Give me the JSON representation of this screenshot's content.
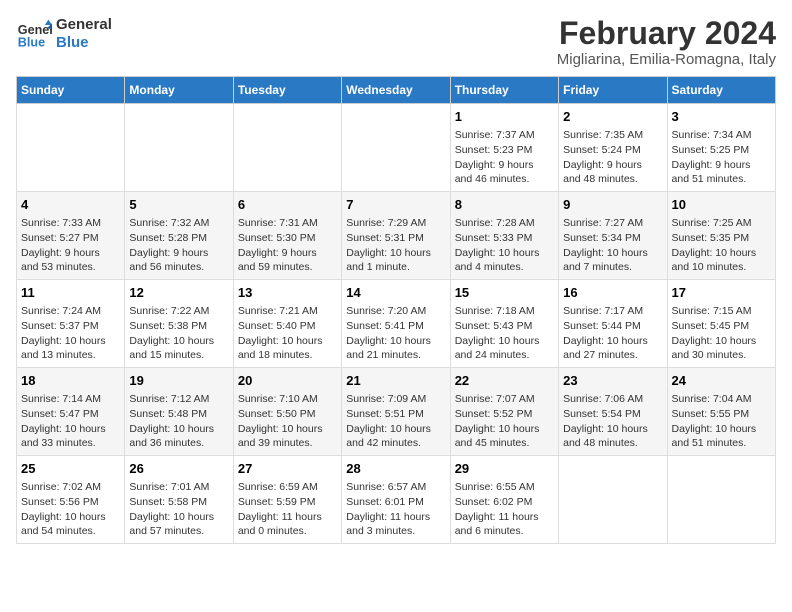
{
  "logo": {
    "line1": "General",
    "line2": "Blue"
  },
  "title": "February 2024",
  "subtitle": "Migliarina, Emilia-Romagna, Italy",
  "weekdays": [
    "Sunday",
    "Monday",
    "Tuesday",
    "Wednesday",
    "Thursday",
    "Friday",
    "Saturday"
  ],
  "weeks": [
    [
      {
        "num": "",
        "info": ""
      },
      {
        "num": "",
        "info": ""
      },
      {
        "num": "",
        "info": ""
      },
      {
        "num": "",
        "info": ""
      },
      {
        "num": "1",
        "info": "Sunrise: 7:37 AM\nSunset: 5:23 PM\nDaylight: 9 hours\nand 46 minutes."
      },
      {
        "num": "2",
        "info": "Sunrise: 7:35 AM\nSunset: 5:24 PM\nDaylight: 9 hours\nand 48 minutes."
      },
      {
        "num": "3",
        "info": "Sunrise: 7:34 AM\nSunset: 5:25 PM\nDaylight: 9 hours\nand 51 minutes."
      }
    ],
    [
      {
        "num": "4",
        "info": "Sunrise: 7:33 AM\nSunset: 5:27 PM\nDaylight: 9 hours\nand 53 minutes."
      },
      {
        "num": "5",
        "info": "Sunrise: 7:32 AM\nSunset: 5:28 PM\nDaylight: 9 hours\nand 56 minutes."
      },
      {
        "num": "6",
        "info": "Sunrise: 7:31 AM\nSunset: 5:30 PM\nDaylight: 9 hours\nand 59 minutes."
      },
      {
        "num": "7",
        "info": "Sunrise: 7:29 AM\nSunset: 5:31 PM\nDaylight: 10 hours\nand 1 minute."
      },
      {
        "num": "8",
        "info": "Sunrise: 7:28 AM\nSunset: 5:33 PM\nDaylight: 10 hours\nand 4 minutes."
      },
      {
        "num": "9",
        "info": "Sunrise: 7:27 AM\nSunset: 5:34 PM\nDaylight: 10 hours\nand 7 minutes."
      },
      {
        "num": "10",
        "info": "Sunrise: 7:25 AM\nSunset: 5:35 PM\nDaylight: 10 hours\nand 10 minutes."
      }
    ],
    [
      {
        "num": "11",
        "info": "Sunrise: 7:24 AM\nSunset: 5:37 PM\nDaylight: 10 hours\nand 13 minutes."
      },
      {
        "num": "12",
        "info": "Sunrise: 7:22 AM\nSunset: 5:38 PM\nDaylight: 10 hours\nand 15 minutes."
      },
      {
        "num": "13",
        "info": "Sunrise: 7:21 AM\nSunset: 5:40 PM\nDaylight: 10 hours\nand 18 minutes."
      },
      {
        "num": "14",
        "info": "Sunrise: 7:20 AM\nSunset: 5:41 PM\nDaylight: 10 hours\nand 21 minutes."
      },
      {
        "num": "15",
        "info": "Sunrise: 7:18 AM\nSunset: 5:43 PM\nDaylight: 10 hours\nand 24 minutes."
      },
      {
        "num": "16",
        "info": "Sunrise: 7:17 AM\nSunset: 5:44 PM\nDaylight: 10 hours\nand 27 minutes."
      },
      {
        "num": "17",
        "info": "Sunrise: 7:15 AM\nSunset: 5:45 PM\nDaylight: 10 hours\nand 30 minutes."
      }
    ],
    [
      {
        "num": "18",
        "info": "Sunrise: 7:14 AM\nSunset: 5:47 PM\nDaylight: 10 hours\nand 33 minutes."
      },
      {
        "num": "19",
        "info": "Sunrise: 7:12 AM\nSunset: 5:48 PM\nDaylight: 10 hours\nand 36 minutes."
      },
      {
        "num": "20",
        "info": "Sunrise: 7:10 AM\nSunset: 5:50 PM\nDaylight: 10 hours\nand 39 minutes."
      },
      {
        "num": "21",
        "info": "Sunrise: 7:09 AM\nSunset: 5:51 PM\nDaylight: 10 hours\nand 42 minutes."
      },
      {
        "num": "22",
        "info": "Sunrise: 7:07 AM\nSunset: 5:52 PM\nDaylight: 10 hours\nand 45 minutes."
      },
      {
        "num": "23",
        "info": "Sunrise: 7:06 AM\nSunset: 5:54 PM\nDaylight: 10 hours\nand 48 minutes."
      },
      {
        "num": "24",
        "info": "Sunrise: 7:04 AM\nSunset: 5:55 PM\nDaylight: 10 hours\nand 51 minutes."
      }
    ],
    [
      {
        "num": "25",
        "info": "Sunrise: 7:02 AM\nSunset: 5:56 PM\nDaylight: 10 hours\nand 54 minutes."
      },
      {
        "num": "26",
        "info": "Sunrise: 7:01 AM\nSunset: 5:58 PM\nDaylight: 10 hours\nand 57 minutes."
      },
      {
        "num": "27",
        "info": "Sunrise: 6:59 AM\nSunset: 5:59 PM\nDaylight: 11 hours\nand 0 minutes."
      },
      {
        "num": "28",
        "info": "Sunrise: 6:57 AM\nSunset: 6:01 PM\nDaylight: 11 hours\nand 3 minutes."
      },
      {
        "num": "29",
        "info": "Sunrise: 6:55 AM\nSunset: 6:02 PM\nDaylight: 11 hours\nand 6 minutes."
      },
      {
        "num": "",
        "info": ""
      },
      {
        "num": "",
        "info": ""
      }
    ]
  ]
}
